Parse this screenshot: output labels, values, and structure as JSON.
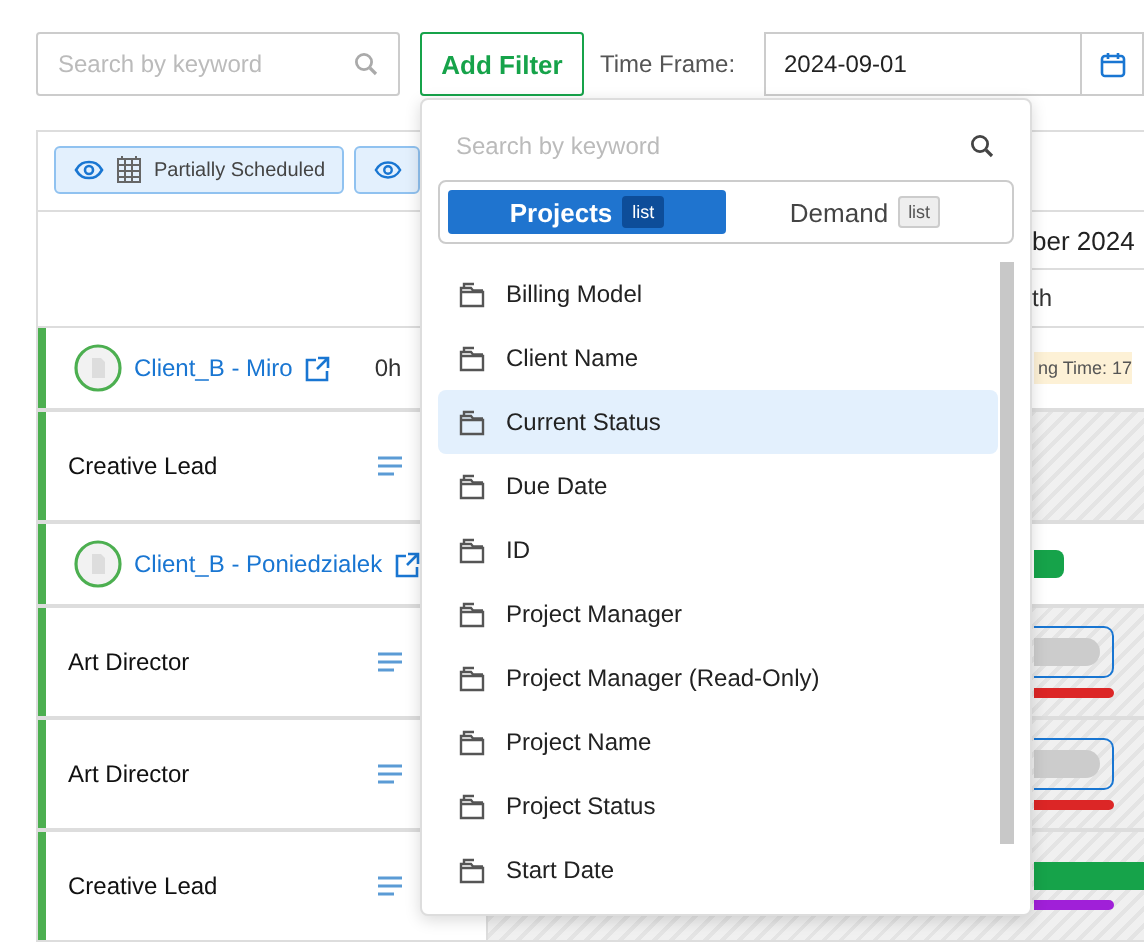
{
  "toolbar": {
    "search": {
      "placeholder": "Search by keyword"
    },
    "add_filter": "Add Filter",
    "time_frame_label": "Time Frame:",
    "date": "2024-09-01"
  },
  "chips": [
    {
      "kind": "labeled",
      "label": "Partially Scheduled"
    },
    {
      "kind": "cut"
    }
  ],
  "timeline": {
    "month": "ber 2024",
    "day": "th"
  },
  "rows": [
    {
      "kind": "project",
      "name": "Client_B - Miro",
      "hours": "0h",
      "badge": "ng Time: 17"
    },
    {
      "kind": "role",
      "name": "Creative Lead",
      "bars": []
    },
    {
      "kind": "project",
      "name": "Client_B - Poniedzialek",
      "bars": [
        {
          "kind": "block",
          "color": "#16a34a"
        }
      ]
    },
    {
      "kind": "role",
      "name": "Art Director",
      "bars": [
        {
          "kind": "outlined",
          "color": "#cccccc"
        },
        {
          "kind": "line",
          "color": "#dc2626"
        }
      ]
    },
    {
      "kind": "role",
      "name": "Art Director",
      "bars": [
        {
          "kind": "outlined",
          "color": "#cccccc"
        },
        {
          "kind": "line",
          "color": "#dc2626"
        }
      ]
    },
    {
      "kind": "role",
      "name": "Creative Lead",
      "bars": [
        {
          "kind": "block",
          "color": "#16a34a"
        },
        {
          "kind": "line",
          "color": "#a020d8"
        }
      ]
    }
  ],
  "dropdown": {
    "search": {
      "placeholder": "Search by keyword"
    },
    "tabs": [
      {
        "label": "Projects",
        "badge": "list",
        "selected": true
      },
      {
        "label": "Demand",
        "badge": "list",
        "selected": false
      }
    ],
    "items": [
      {
        "label": "Billing Model",
        "selected": false
      },
      {
        "label": "Client Name",
        "selected": false
      },
      {
        "label": "Current Status",
        "selected": true
      },
      {
        "label": "Due Date",
        "selected": false
      },
      {
        "label": "ID",
        "selected": false
      },
      {
        "label": "Project Manager",
        "selected": false
      },
      {
        "label": "Project Manager (Read-Only)",
        "selected": false
      },
      {
        "label": "Project Name",
        "selected": false
      },
      {
        "label": "Project Status",
        "selected": false
      },
      {
        "label": "Start Date",
        "selected": false
      }
    ]
  }
}
